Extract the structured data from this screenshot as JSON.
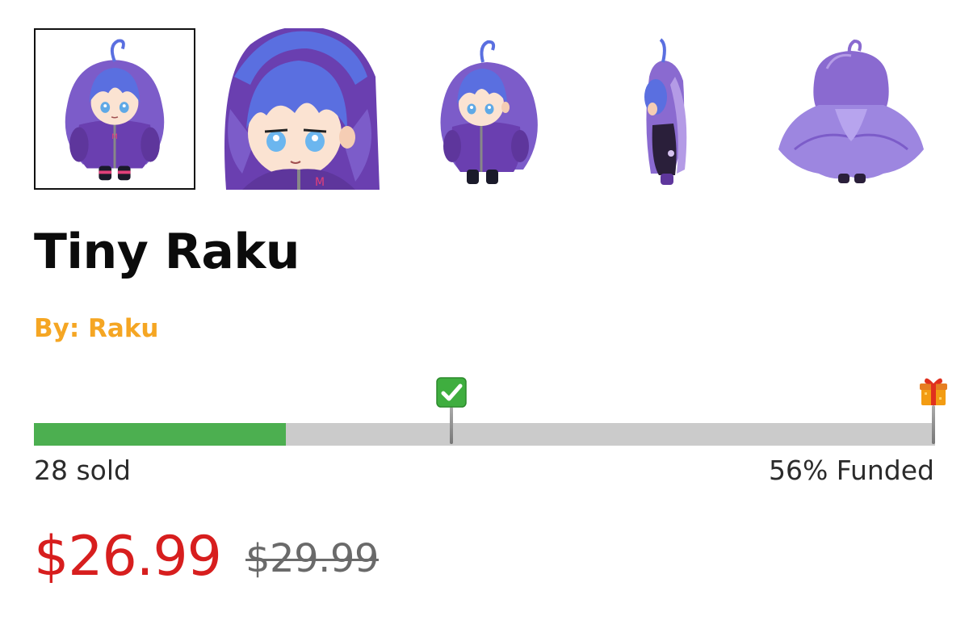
{
  "gallery": {
    "thumbnails": [
      {
        "label": "front-view",
        "selected": true
      },
      {
        "label": "face-closeup",
        "selected": false
      },
      {
        "label": "three-quarter-view",
        "selected": false
      },
      {
        "label": "side-view",
        "selected": false
      },
      {
        "label": "back-view",
        "selected": false
      }
    ]
  },
  "product": {
    "title": "Tiny Raku",
    "byline_prefix": "By: ",
    "creator": "Raku"
  },
  "funding": {
    "progress_fraction": 0.28,
    "milestone_fraction": 0.463,
    "milestone_icon": "check-mark-icon",
    "goal_icon": "gift-icon",
    "sold_text": "28 sold",
    "funded_text": "56% Funded",
    "colors": {
      "fill": "#4caf50",
      "track": "#cbcbcb"
    }
  },
  "pricing": {
    "current_price": "$26.99",
    "original_price": "$29.99",
    "colors": {
      "current": "#d71e1e",
      "original": "#6a6a6a"
    }
  },
  "colors": {
    "byline": "#f5a623",
    "plush_hair": "#5a6fe0",
    "plush_jacket": "#6a3fb0"
  }
}
